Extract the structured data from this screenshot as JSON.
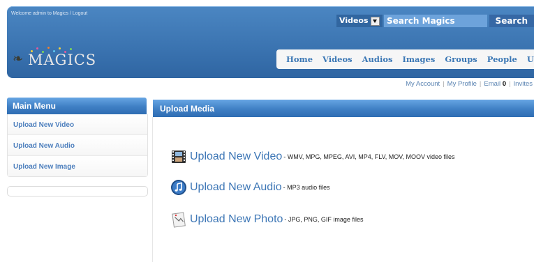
{
  "header": {
    "welcome_text": "Welcome admin to Magics",
    "separator": "/",
    "logout_label": "Logout",
    "search": {
      "category_value": "Videos",
      "placeholder": "Search Magics",
      "button_label": "Search"
    },
    "logo_text": "MAGICS"
  },
  "nav": {
    "items": [
      "Home",
      "Videos",
      "Audios",
      "Images",
      "Groups",
      "People",
      "Upload"
    ]
  },
  "sublinks": {
    "my_account": "My Account",
    "my_profile": "My Profile",
    "email_label": "Email",
    "email_count": "0",
    "invites": "Invites"
  },
  "sidebar": {
    "title": "Main Menu",
    "items": [
      "Upload New Video",
      "Upload New Audio",
      "Upload New Image"
    ]
  },
  "main": {
    "title": "Upload Media",
    "uploads": [
      {
        "icon": "film-icon",
        "label": "Upload New Video",
        "desc": "- WMV, MPG, MPEG, AVI, MP4, FLV, MOV, MOOV video files"
      },
      {
        "icon": "music-note-icon",
        "label": "Upload New Audio",
        "desc": "- MP3 audio files"
      },
      {
        "icon": "photo-icon",
        "label": "Upload New Photo",
        "desc": "- JPG, PNG, GIF image files"
      }
    ]
  },
  "colors": {
    "header_blue": "#3a73b0",
    "link_blue": "#3e77b6",
    "panel_blue": "#3f7fc4"
  }
}
